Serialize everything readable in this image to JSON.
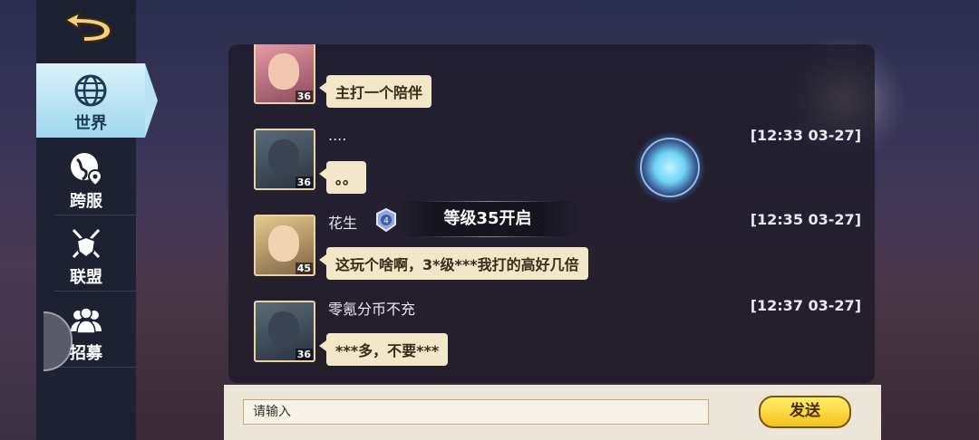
{
  "nav": {
    "tabs": [
      {
        "label": "世界",
        "icon": "globe-icon",
        "active": true
      },
      {
        "label": "跨服",
        "icon": "globe-pin-icon",
        "active": false
      },
      {
        "label": "联盟",
        "icon": "crossed-swords-shield-icon",
        "active": false
      },
      {
        "label": "招募",
        "icon": "people-group-icon",
        "active": false
      }
    ]
  },
  "chat": {
    "messages": [
      {
        "name": "",
        "time": "",
        "text": "主打一个陪伴",
        "level": "36"
      },
      {
        "name": "....",
        "time": "[12:33 03-27]",
        "text": "。。",
        "level": "36"
      },
      {
        "name": "花生",
        "time": "[12:35 03-27]",
        "text": "这玩个啥啊，3*级***我打的高好几倍",
        "level": "45",
        "badge": "4"
      },
      {
        "name": "零氪分币不充",
        "time": "[12:37 03-27]",
        "text": "***多，不要***",
        "level": "36"
      }
    ],
    "level_notice": "等级35开启"
  },
  "input": {
    "placeholder": "请输入",
    "send_label": "发送"
  },
  "colors": {
    "active_tab": "#b7e3f2",
    "bubble": "#f2e7c9",
    "send_button": "#f4c21c",
    "rail": "#1e2131"
  }
}
